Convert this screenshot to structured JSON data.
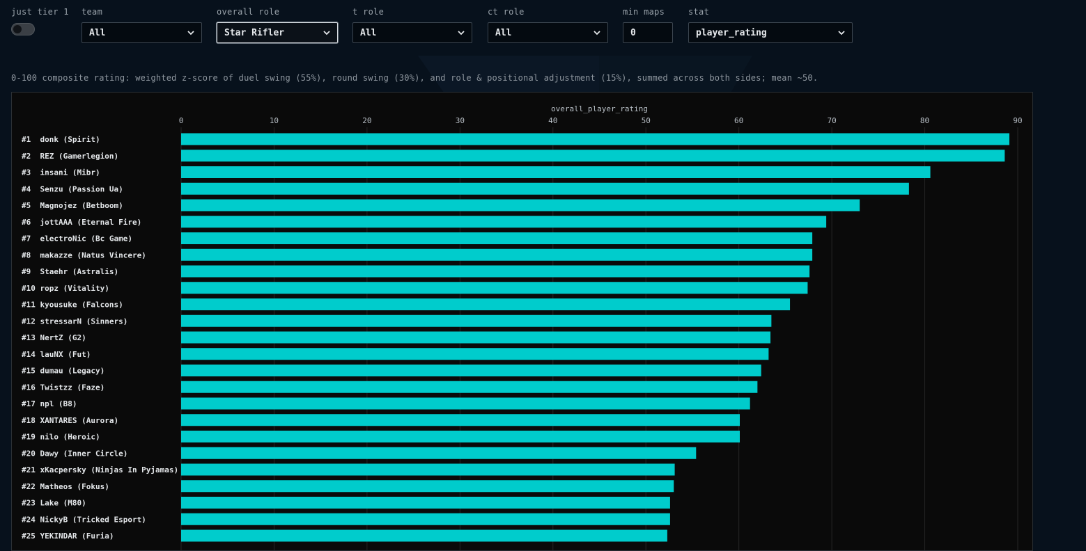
{
  "filters": {
    "tier": {
      "label": "just tier 1",
      "checked": false
    },
    "team": {
      "label": "team",
      "value": "All"
    },
    "overall_role": {
      "label": "overall role",
      "value": "Star Rifler"
    },
    "t_role": {
      "label": "t role",
      "value": "All"
    },
    "ct_role": {
      "label": "ct role",
      "value": "All"
    },
    "min_maps": {
      "label": "min maps",
      "value": "0"
    },
    "stat": {
      "label": "stat",
      "value": "player_rating"
    }
  },
  "description": "0-100 composite rating: weighted z-score of duel swing (55%), round swing (30%), and role & positional adjustment (15%), summed across both sides; mean ~50.",
  "colors": {
    "bar": "#00cccc",
    "background": "#07111c",
    "panel": "#0a0a0a",
    "grid": "#262626"
  },
  "chart_data": {
    "type": "bar",
    "orientation": "horizontal",
    "title": "overall_player_rating",
    "xlim": [
      0,
      90
    ],
    "x_ticks": [
      0,
      10,
      20,
      30,
      40,
      50,
      60,
      70,
      80,
      90
    ],
    "grid": true,
    "categories": [
      "#1  donk (Spirit)",
      "#2  REZ (Gamerlegion)",
      "#3  insani (Mibr)",
      "#4  Senzu (Passion Ua)",
      "#5  Magnojez (Betboom)",
      "#6  jottAAA (Eternal Fire)",
      "#7  electroNic (Bc Game)",
      "#8  makazze (Natus Vincere)",
      "#9  Staehr (Astralis)",
      "#10 ropz (Vitality)",
      "#11 kyousuke (Falcons)",
      "#12 stressarN (Sinners)",
      "#13 NertZ (G2)",
      "#14 lauNX (Fut)",
      "#15 dumau (Legacy)",
      "#16 Twistzz (Faze)",
      "#17 npl (B8)",
      "#18 XANTARES (Aurora)",
      "#19 nilo (Heroic)",
      "#20 Dawy (Inner Circle)",
      "#21 xKacpersky (Ninjas In Pyjamas)",
      "#22 Matheos (Fokus)",
      "#23 Lake (M80)",
      "#24 NickyB (Tricked Esport)",
      "#25 YEKINDAR (Furia)"
    ],
    "values": [
      89.1,
      88.6,
      80.6,
      78.3,
      73.0,
      69.4,
      67.9,
      67.9,
      67.6,
      67.4,
      65.5,
      63.5,
      63.4,
      63.2,
      62.4,
      62.0,
      61.2,
      60.1,
      60.1,
      55.4,
      53.1,
      53.0,
      52.6,
      52.6,
      52.3
    ]
  }
}
